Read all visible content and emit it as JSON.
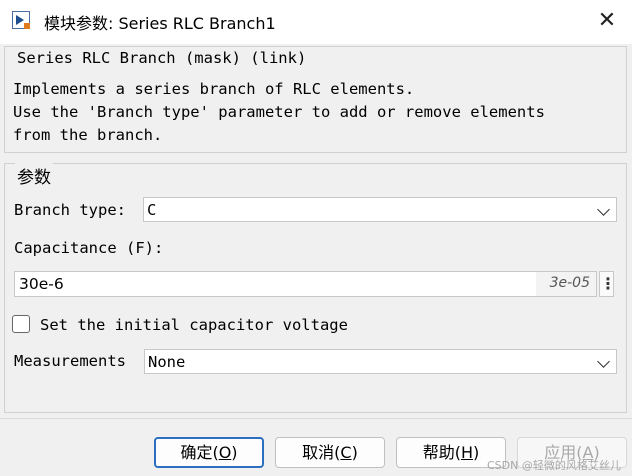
{
  "window": {
    "title": "模块参数: Series RLC Branch1",
    "app_icon": "simulink-block-icon",
    "close_glyph": "✕"
  },
  "description": {
    "header": "Series RLC Branch (mask) (link)",
    "lines": [
      "Implements a series branch of RLC elements.",
      "Use the 'Branch type' parameter to add or remove elements",
      "from the branch."
    ]
  },
  "parameters": {
    "legend": "参数",
    "branch_type": {
      "label": "Branch type:",
      "value": "C"
    },
    "capacitance": {
      "label": "Capacitance (F):",
      "value": "30e-6",
      "evaluated": "3e-05",
      "menu_glyph": "⋮"
    },
    "initial_voltage": {
      "label": "Set the initial capacitor voltage",
      "checked": false
    },
    "measurements": {
      "label": "Measurements",
      "value": "None"
    }
  },
  "buttons": {
    "ok_prefix": "确定(",
    "ok_key": "O",
    "ok_suffix": ")",
    "cancel_prefix": "取消(",
    "cancel_key": "C",
    "cancel_suffix": ")",
    "help_prefix": "帮助(",
    "help_key": "H",
    "help_suffix": ")",
    "apply_prefix": "应用(",
    "apply_key": "A",
    "apply_suffix": ")"
  },
  "watermark": "CSDN @轻微的风格艾丝儿"
}
